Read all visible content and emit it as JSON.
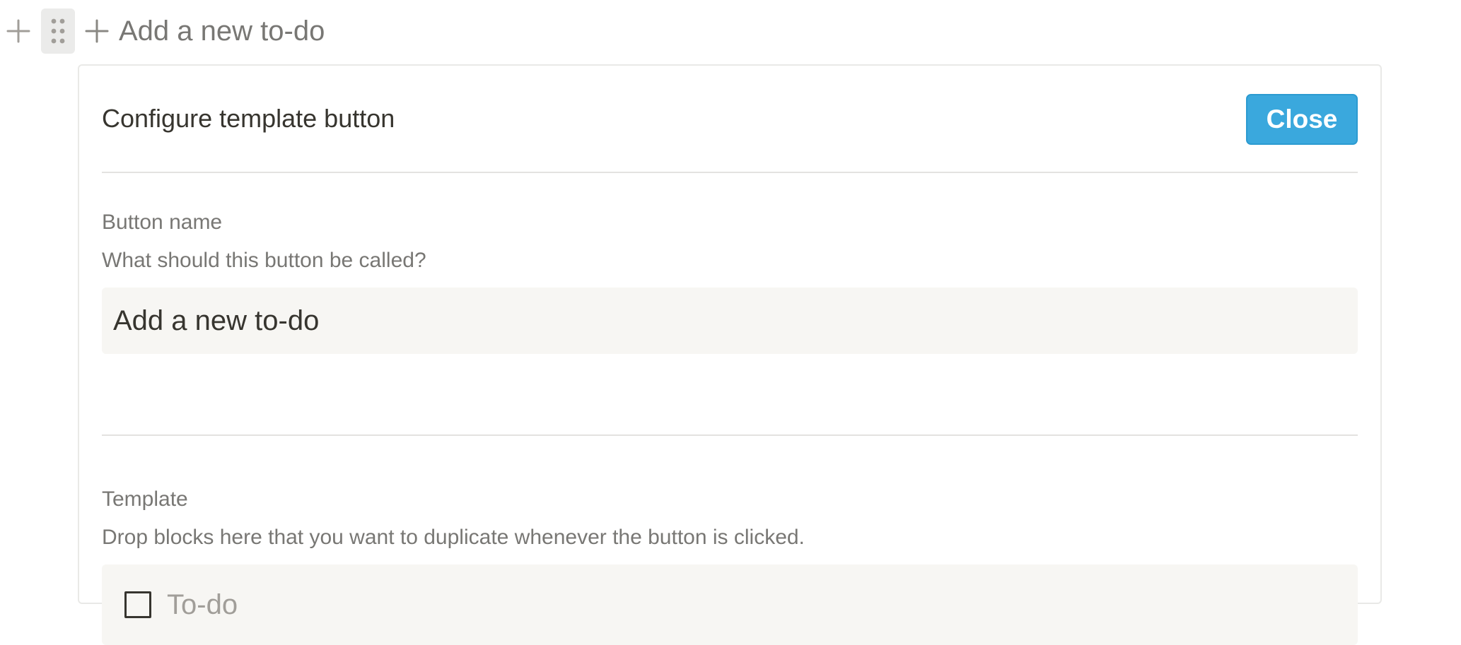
{
  "block": {
    "add_icon": "plus-icon",
    "drag_icon": "drag-handle-icon",
    "button_icon": "plus-icon",
    "button_label": "Add a new to-do"
  },
  "panel": {
    "title": "Configure template button",
    "close_label": "Close",
    "button_name": {
      "label": "Button name",
      "description": "What should this button be called?",
      "value": "Add a new to-do"
    },
    "template": {
      "label": "Template",
      "description": "Drop blocks here that you want to duplicate whenever the button is clicked.",
      "todo_placeholder": "To-do"
    }
  },
  "colors": {
    "accent": "#3aa8dd",
    "text": "#37352f",
    "muted_text": "#787774",
    "input_background": "#f7f6f3",
    "border": "#e9e9e7"
  }
}
